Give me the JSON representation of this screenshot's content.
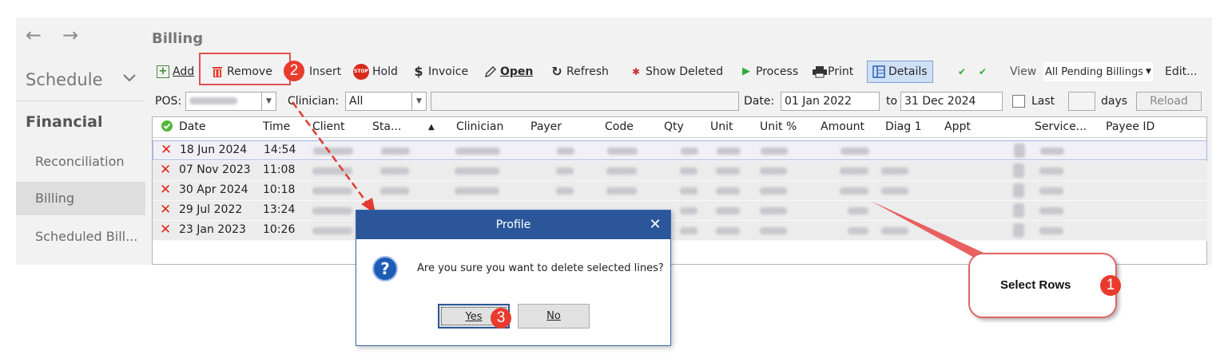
{
  "nav": {
    "back_icon": "←",
    "forward_icon": "→",
    "schedule": "Schedule",
    "chevron": "﹀",
    "financial": "Financial",
    "items": [
      "Reconciliation",
      "Billing",
      "Scheduled Bill..."
    ]
  },
  "main": {
    "title": "Billing",
    "toolbar": {
      "add": "Add",
      "remove": "Remove",
      "insert": "Insert",
      "hold": "Hold",
      "invoice": "Invoice",
      "open": "Open",
      "refresh": "Refresh",
      "show_deleted": "Show Deleted",
      "process": "Process",
      "print": "Print",
      "details": "Details",
      "view": "View",
      "view_value": "All Pending Billings",
      "edit": "Edit..."
    },
    "filters": {
      "pos_label": "POS:",
      "clinician_label": "Clinician:",
      "clinician_value": "All",
      "date_label": "Date:",
      "date_from": "01 Jan 2022",
      "to_label": "to",
      "date_to": "31 Dec 2024",
      "last_label": "Last",
      "days_label": "days",
      "reload": "Reload"
    },
    "grid": {
      "columns": [
        "Date",
        "Time",
        "Client",
        "Sta...",
        "Clinician",
        "Payer",
        "Code",
        "Qty",
        "Unit",
        "Unit %",
        "Amount",
        "Diag 1",
        "Appt",
        "Service...",
        "Payee ID"
      ],
      "rows": [
        {
          "date": "18 Jun 2024",
          "time": "14:54"
        },
        {
          "date": "07 Nov 2023",
          "time": "11:08"
        },
        {
          "date": "30 Apr 2024",
          "time": "10:18"
        },
        {
          "date": "29 Jul 2022",
          "time": "13:24"
        },
        {
          "date": "23 Jan 2023",
          "time": "10:26"
        }
      ]
    }
  },
  "dialog": {
    "title": "Profile",
    "close": "✕",
    "message": "Are you sure you want to delete selected lines?",
    "yes": "Yes",
    "no": "No"
  },
  "annotations": {
    "callout_text": "Select Rows",
    "badge1": "1",
    "badge2": "2",
    "badge3": "3"
  },
  "colors": {
    "accent": "#2b579a",
    "annotation_red": "#e83b2e",
    "delete_x": "#e02a1a"
  }
}
